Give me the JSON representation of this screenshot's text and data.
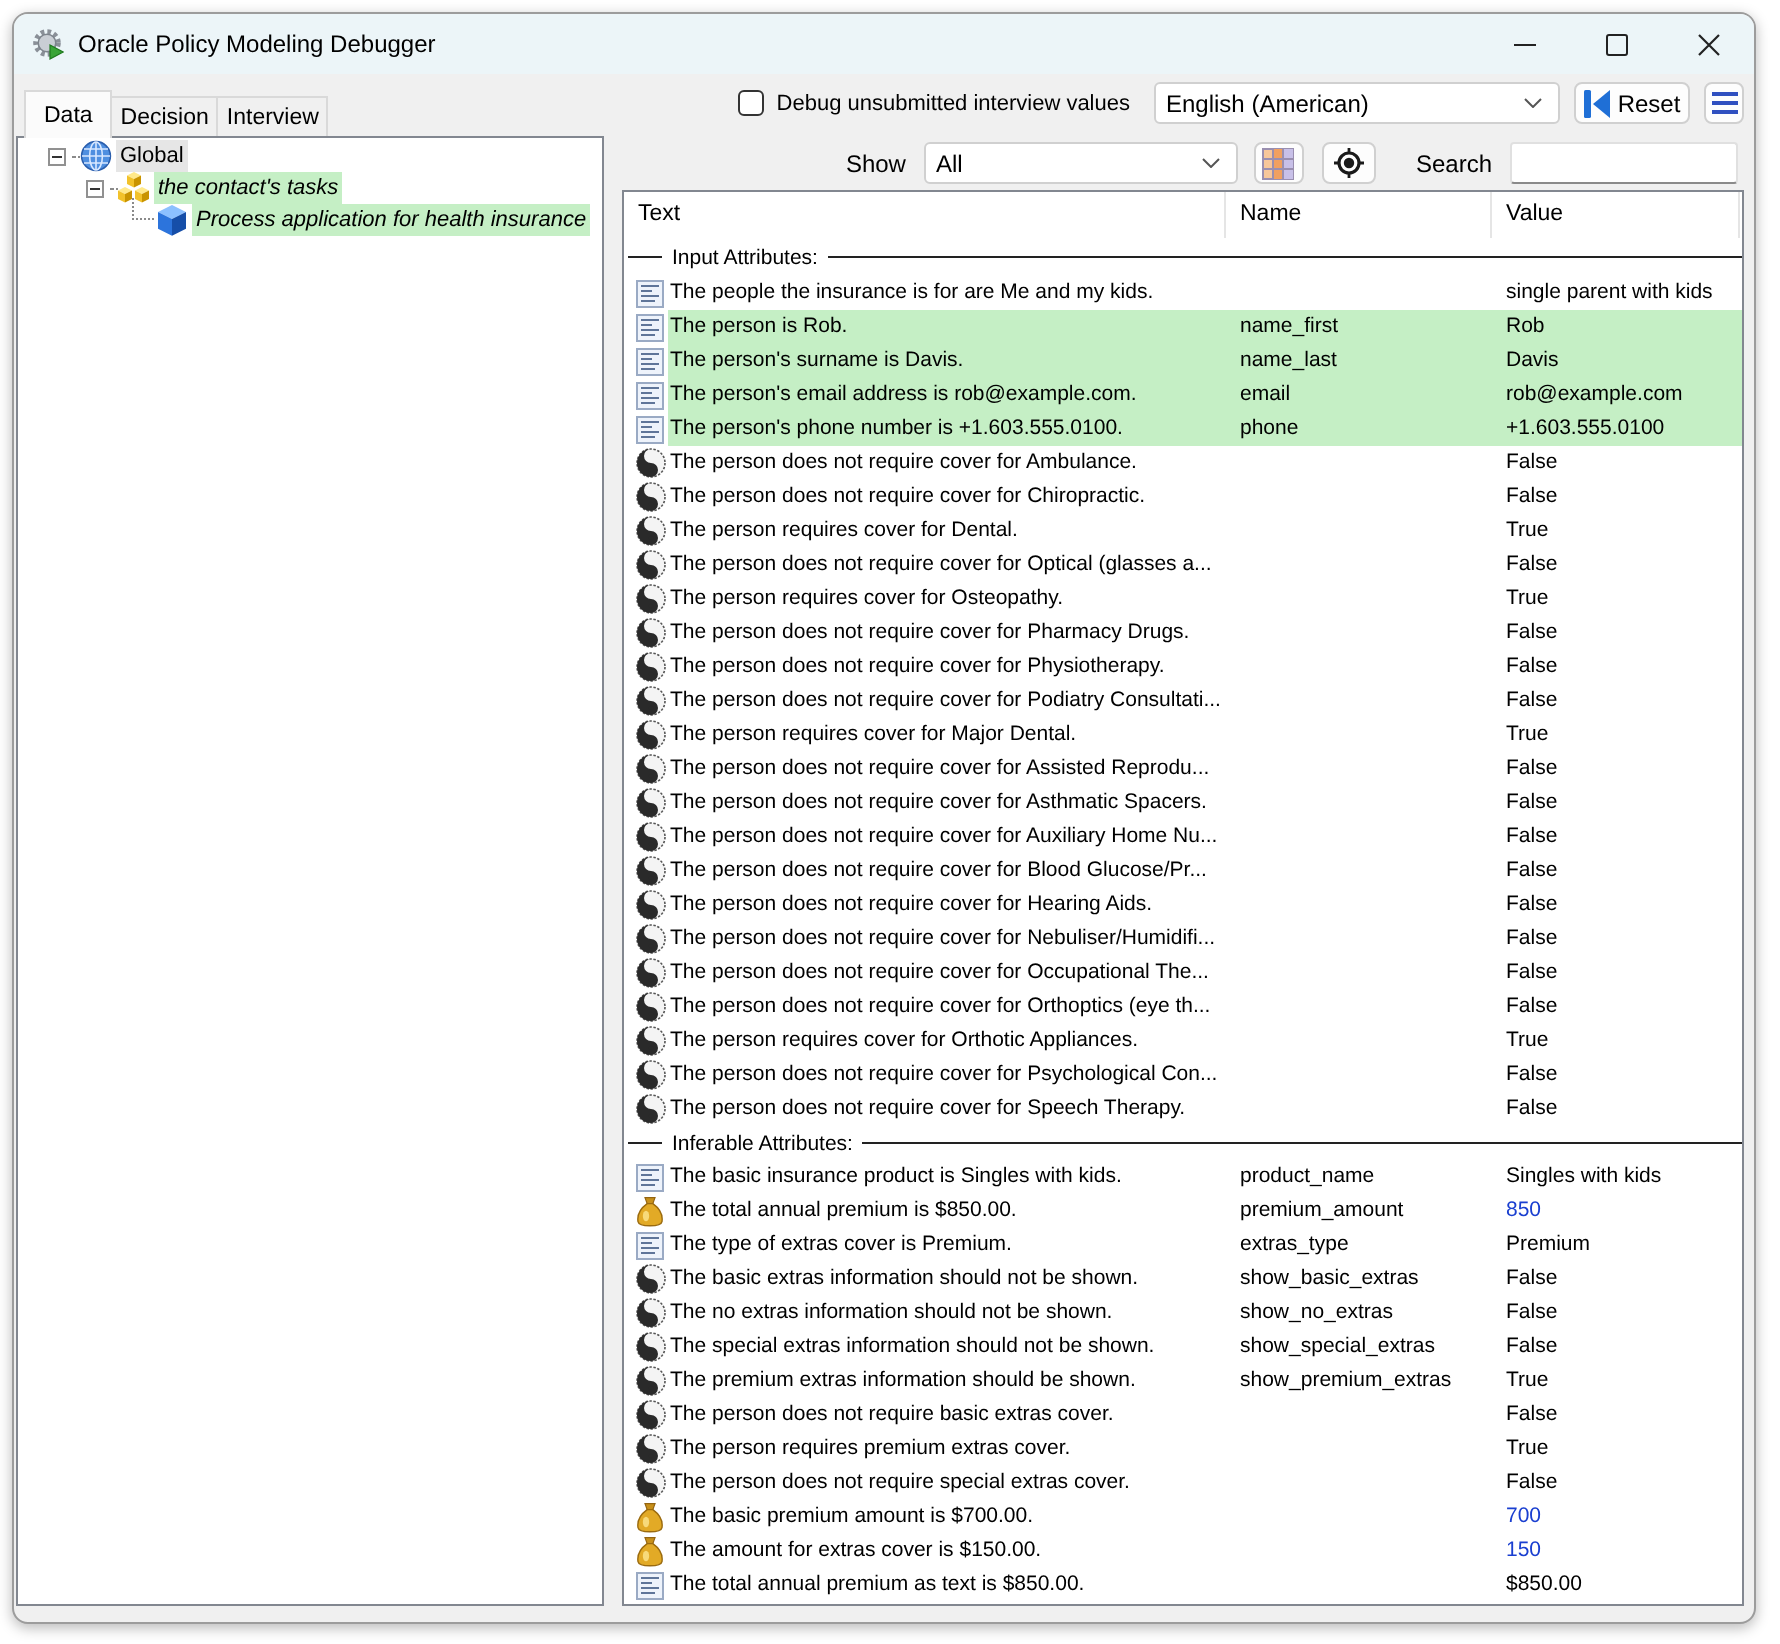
{
  "window": {
    "title": "Oracle Policy Modeling Debugger"
  },
  "tabs": [
    {
      "label": "Data",
      "selected": true
    },
    {
      "label": "Decision",
      "selected": false
    },
    {
      "label": "Interview",
      "selected": false
    }
  ],
  "tree": [
    {
      "label": "Global",
      "kind": "global",
      "selected": true,
      "highlighted": false,
      "expanded": true,
      "children": [
        {
          "label": "the contact's tasks",
          "kind": "entity",
          "selected": false,
          "highlighted": true,
          "expanded": true,
          "children": [
            {
              "label": "Process application for health insurance",
              "kind": "instance",
              "selected": false,
              "highlighted": true
            }
          ]
        }
      ]
    }
  ],
  "toolbar": {
    "debug_checkbox": {
      "label": "Debug unsubmitted interview values",
      "checked": false
    },
    "language": "English (American)",
    "reset": "Reset"
  },
  "filter": {
    "show_label": "Show",
    "show_value": "All",
    "search_label": "Search"
  },
  "table": {
    "columns": [
      "Text",
      "Name",
      "Value"
    ],
    "groups": [
      {
        "title": "Input Attributes:",
        "rows": [
          {
            "kind": "text",
            "text": "The people the insurance is for are Me and my kids.",
            "value": "single parent with kids",
            "highlighted": false
          },
          {
            "kind": "text",
            "text": "The person is Rob.",
            "name": "name_first",
            "value": "Rob",
            "highlighted": true
          },
          {
            "kind": "text",
            "text": "The person's surname is Davis.",
            "name": "name_last",
            "value": "Davis",
            "highlighted": true
          },
          {
            "kind": "text",
            "text": "The person's email address is rob@example.com.",
            "name": "email",
            "value": "rob@example.com",
            "highlighted": true
          },
          {
            "kind": "text",
            "text": "The person's phone number is +1.603.555.0100.",
            "name": "phone",
            "value": "+1.603.555.0100",
            "highlighted": true
          },
          {
            "kind": "boolean",
            "text": "The person does not require cover for Ambulance.",
            "value": "False",
            "highlighted": false
          },
          {
            "kind": "boolean",
            "text": "The person does not require cover for Chiropractic.",
            "value": "False",
            "highlighted": false
          },
          {
            "kind": "boolean",
            "text": "The person requires cover for Dental.",
            "value": "True",
            "highlighted": false
          },
          {
            "kind": "boolean",
            "text": "The person does not require cover for Optical (glasses a...",
            "value": "False",
            "highlighted": false
          },
          {
            "kind": "boolean",
            "text": "The person requires cover for Osteopathy.",
            "value": "True",
            "highlighted": false
          },
          {
            "kind": "boolean",
            "text": "The person does not require cover for Pharmacy Drugs.",
            "value": "False",
            "highlighted": false
          },
          {
            "kind": "boolean",
            "text": "The person does not require cover for Physiotherapy.",
            "value": "False",
            "highlighted": false
          },
          {
            "kind": "boolean",
            "text": "The person does not require cover for Podiatry Consultati...",
            "value": "False",
            "highlighted": false
          },
          {
            "kind": "boolean",
            "text": "The person requires cover for Major Dental.",
            "value": "True",
            "highlighted": false
          },
          {
            "kind": "boolean",
            "text": "The person does not require cover for Assisted Reprodu...",
            "value": "False",
            "highlighted": false
          },
          {
            "kind": "boolean",
            "text": "The person does not require cover for Asthmatic Spacers.",
            "value": "False",
            "highlighted": false
          },
          {
            "kind": "boolean",
            "text": "The person does not require cover for Auxiliary Home Nu...",
            "value": "False",
            "highlighted": false
          },
          {
            "kind": "boolean",
            "text": "The person does not require cover for Blood Glucose/Pr...",
            "value": "False",
            "highlighted": false
          },
          {
            "kind": "boolean",
            "text": "The person does not require cover for Hearing Aids.",
            "value": "False",
            "highlighted": false
          },
          {
            "kind": "boolean",
            "text": "The person does not require cover for Nebuliser/Humidifi...",
            "value": "False",
            "highlighted": false
          },
          {
            "kind": "boolean",
            "text": "The person does not require cover for Occupational The...",
            "value": "False",
            "highlighted": false
          },
          {
            "kind": "boolean",
            "text": "The person does not require cover for Orthoptics (eye th...",
            "value": "False",
            "highlighted": false
          },
          {
            "kind": "boolean",
            "text": "The person requires cover for Orthotic Appliances.",
            "value": "True",
            "highlighted": false
          },
          {
            "kind": "boolean",
            "text": "The person does not require cover for Psychological Con...",
            "value": "False",
            "highlighted": false
          },
          {
            "kind": "boolean",
            "text": "The person does not require cover for Speech Therapy.",
            "value": "False",
            "highlighted": false
          }
        ]
      },
      {
        "title": "Inferable Attributes:",
        "rows": [
          {
            "kind": "text",
            "text": "The basic insurance product is Singles with kids.",
            "name": "product_name",
            "value": "Singles with kids",
            "highlighted": false
          },
          {
            "kind": "currency",
            "text": "The total annual premium is $850.00.",
            "name": "premium_amount",
            "value": "850",
            "highlighted": false
          },
          {
            "kind": "text",
            "text": "The type of extras cover is Premium.",
            "name": "extras_type",
            "value": "Premium",
            "highlighted": false
          },
          {
            "kind": "boolean",
            "text": "The basic extras information should not be shown.",
            "name": "show_basic_extras",
            "value": "False",
            "highlighted": false
          },
          {
            "kind": "boolean",
            "text": "The no extras information should not be shown.",
            "name": "show_no_extras",
            "value": "False",
            "highlighted": false
          },
          {
            "kind": "boolean",
            "text": "The special extras information should not be shown.",
            "name": "show_special_extras",
            "value": "False",
            "highlighted": false
          },
          {
            "kind": "boolean",
            "text": "The premium extras information should be shown.",
            "name": "show_premium_extras",
            "value": "True",
            "highlighted": false
          },
          {
            "kind": "boolean",
            "text": "The person does not require basic extras cover.",
            "value": "False",
            "highlighted": false
          },
          {
            "kind": "boolean",
            "text": "The person requires premium extras cover.",
            "value": "True",
            "highlighted": false
          },
          {
            "kind": "boolean",
            "text": "The person does not require special extras cover.",
            "value": "False",
            "highlighted": false
          },
          {
            "kind": "currency",
            "text": "The basic premium amount is $700.00.",
            "value": "700",
            "highlighted": false
          },
          {
            "kind": "currency",
            "text": "The amount for extras cover is $150.00.",
            "value": "150",
            "highlighted": false
          },
          {
            "kind": "text",
            "text": "The total annual premium as text is $850.00.",
            "value": "$850.00",
            "highlighted": false
          }
        ]
      }
    ]
  }
}
